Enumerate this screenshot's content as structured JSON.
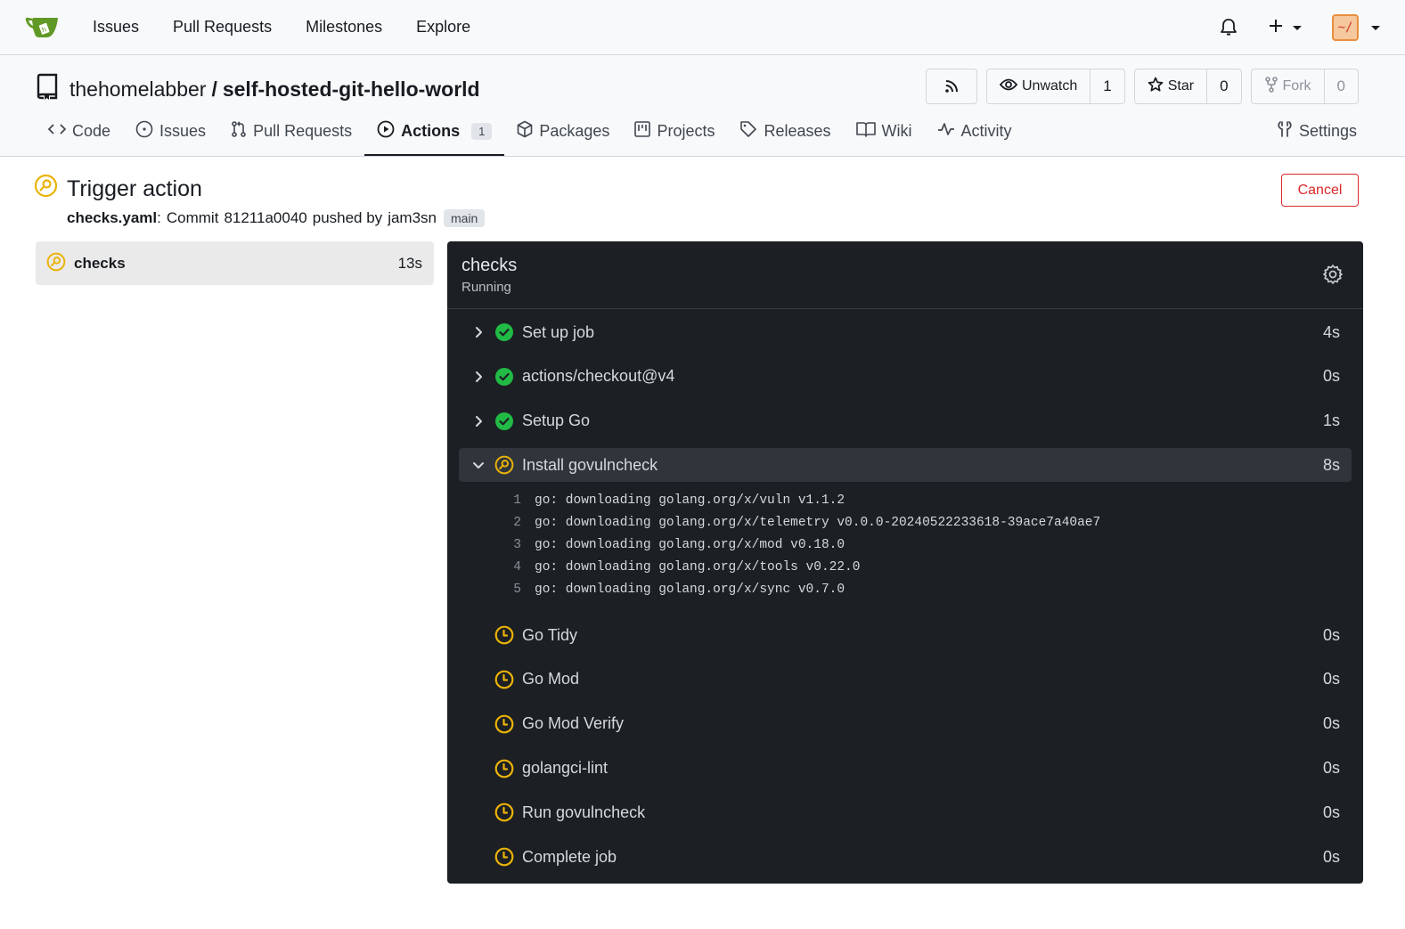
{
  "navbar": {
    "links": [
      "Issues",
      "Pull Requests",
      "Milestones",
      "Explore"
    ],
    "avatar_text": "~/",
    "icons": [
      "gitea-logo-icon",
      "bell-icon",
      "plus-icon",
      "caret-down-icon"
    ]
  },
  "repo": {
    "owner": "thehomelabber",
    "separator": "/",
    "name": "self-hosted-git-hello-world",
    "unwatch_label": "Unwatch",
    "watch_count": "1",
    "star_label": "Star",
    "star_count": "0",
    "fork_label": "Fork",
    "fork_count": "0",
    "tabs": [
      {
        "label": "Code",
        "icon": "code-icon"
      },
      {
        "label": "Issues",
        "icon": "issue-opened-icon"
      },
      {
        "label": "Pull Requests",
        "icon": "git-pull-request-icon"
      },
      {
        "label": "Actions",
        "icon": "play-icon",
        "badge": "1",
        "active": true
      },
      {
        "label": "Packages",
        "icon": "package-icon"
      },
      {
        "label": "Projects",
        "icon": "project-icon"
      },
      {
        "label": "Releases",
        "icon": "tag-icon"
      },
      {
        "label": "Wiki",
        "icon": "book-icon"
      },
      {
        "label": "Activity",
        "icon": "pulse-icon"
      },
      {
        "label": "Settings",
        "icon": "tools-icon"
      }
    ]
  },
  "run": {
    "title": "Trigger action",
    "workflow": "checks.yaml",
    "colon": ":",
    "commit_prefix": "Commit",
    "commit": "81211a0040",
    "pushed_by": "pushed by",
    "user": "jam3sn",
    "branch": "main",
    "cancel_label": "Cancel",
    "status_color": "#eab308"
  },
  "jobs": [
    {
      "name": "checks",
      "duration": "13s",
      "status": "running"
    }
  ],
  "log": {
    "job_name": "checks",
    "job_status": "Running",
    "steps": [
      {
        "label": "Set up job",
        "duration": "4s",
        "status": "success"
      },
      {
        "label": "actions/checkout@v4",
        "duration": "0s",
        "status": "success"
      },
      {
        "label": "Setup Go",
        "duration": "1s",
        "status": "success"
      },
      {
        "label": "Install govulncheck",
        "duration": "8s",
        "status": "running",
        "expanded": true,
        "lines": [
          {
            "n": "1",
            "text": "go: downloading golang.org/x/vuln v1.1.2"
          },
          {
            "n": "2",
            "text": "go: downloading golang.org/x/telemetry v0.0.0-20240522233618-39ace7a40ae7"
          },
          {
            "n": "3",
            "text": "go: downloading golang.org/x/mod v0.18.0"
          },
          {
            "n": "4",
            "text": "go: downloading golang.org/x/tools v0.22.0"
          },
          {
            "n": "5",
            "text": "go: downloading golang.org/x/sync v0.7.0"
          }
        ]
      },
      {
        "label": "Go Tidy",
        "duration": "0s",
        "status": "waiting"
      },
      {
        "label": "Go Mod",
        "duration": "0s",
        "status": "waiting"
      },
      {
        "label": "Go Mod Verify",
        "duration": "0s",
        "status": "waiting"
      },
      {
        "label": "golangci-lint",
        "duration": "0s",
        "status": "waiting"
      },
      {
        "label": "Run govulncheck",
        "duration": "0s",
        "status": "waiting"
      },
      {
        "label": "Complete job",
        "duration": "0s",
        "status": "waiting"
      }
    ]
  }
}
